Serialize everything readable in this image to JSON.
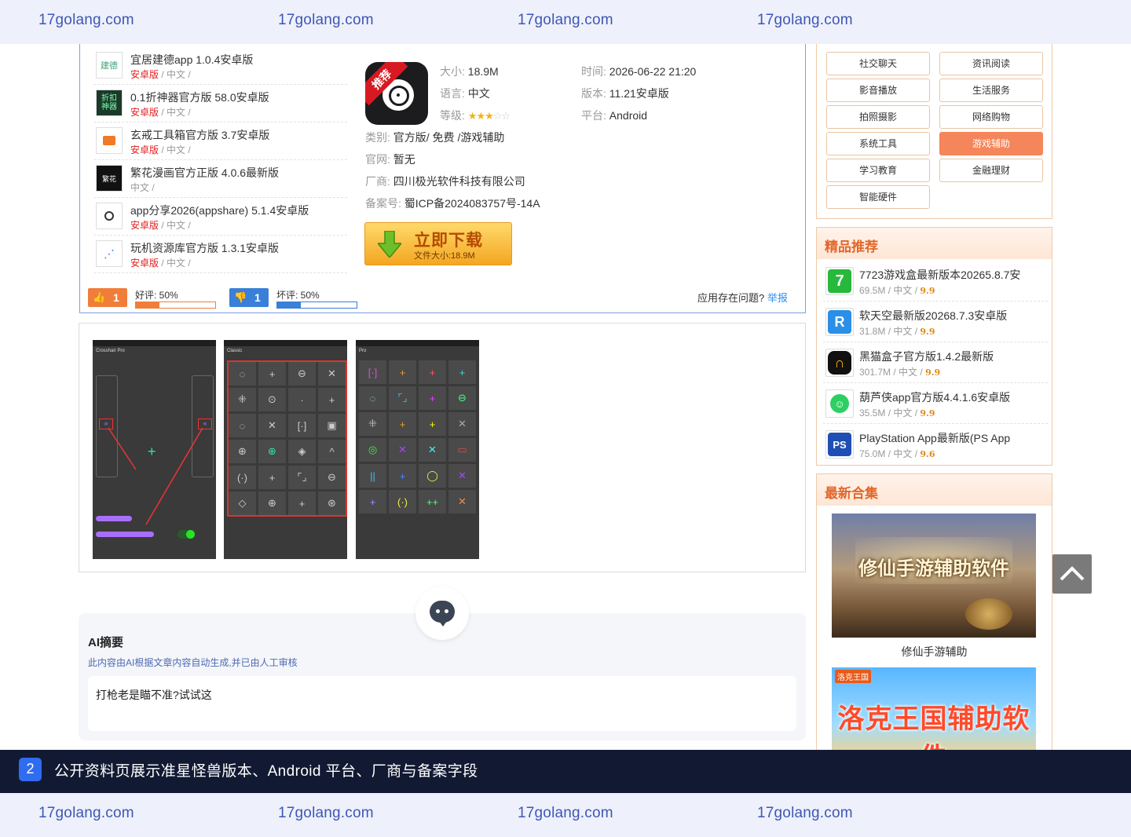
{
  "watermark": "17golang.com",
  "related_apps": [
    {
      "title": "宜居建德app 1.0.4安卓版",
      "platform": "安卓版",
      "lang": "中文",
      "icon": "yijujiande-app-icon"
    },
    {
      "title": "0.1折神器官方版 58.0安卓版",
      "platform": "安卓版",
      "lang": "中文",
      "icon": "discount-app-icon"
    },
    {
      "title": "玄戒工具箱官方版 3.7安卓版",
      "platform": "安卓版",
      "lang": "中文",
      "icon": "toolbox-app-icon"
    },
    {
      "title": "繁花漫画官方正版 4.0.6最新版",
      "platform": "",
      "lang": "中文",
      "icon": "fanhua-comic-app-icon"
    },
    {
      "title": "app分享2026(appshare) 5.1.4安卓版",
      "platform": "安卓版",
      "lang": "中文",
      "icon": "appshare-app-icon"
    },
    {
      "title": "玩机资源库官方版 1.3.1安卓版",
      "platform": "安卓版",
      "lang": "中文",
      "icon": "resource-app-icon"
    }
  ],
  "app": {
    "badge": "推荐",
    "size_label": "大小:",
    "size": "18.9M",
    "lang_label": "语言:",
    "lang": "中文",
    "rating_label": "等级:",
    "stars": 3,
    "stars_total": 5,
    "time_label": "时间:",
    "time": "2026-06-22 21:20",
    "version_label": "版本:",
    "version": "11.21安卓版",
    "platform_label": "平台:",
    "platform": "Android",
    "category_label": "类别:",
    "category": "官方版/ 免费 /游戏辅助",
    "site_label": "官网:",
    "site": "暂无",
    "vendor_label": "厂商:",
    "vendor": "四川极光软件科技有限公司",
    "icp_label": "备案号:",
    "icp": "蜀ICP备2024083757号-14A",
    "download_label": "立即下载",
    "download_size": "文件大小:18.9M"
  },
  "votes": {
    "up_count": "1",
    "up_label": "好评: 50%",
    "up_pct": 0.3,
    "down_count": "1",
    "down_label": "坏评: 50%",
    "down_pct": 0.3,
    "problem_text": "应用存在问题?",
    "report_link": "举报"
  },
  "screenshots": [
    {
      "title": "Crosshair Pro"
    },
    {
      "title": "Classic"
    },
    {
      "title": "Pro"
    }
  ],
  "ai_summary": {
    "title": "AI摘要",
    "note": "此内容由AI根据文章内容自动生成,并已由人工审核",
    "text": "打枪老是瞄不准?试试这"
  },
  "categories": [
    {
      "label": "社交聊天",
      "active": false
    },
    {
      "label": "资讯阅读",
      "active": false
    },
    {
      "label": "影音播放",
      "active": false
    },
    {
      "label": "生活服务",
      "active": false
    },
    {
      "label": "拍照摄影",
      "active": false
    },
    {
      "label": "网络购物",
      "active": false
    },
    {
      "label": "系统工具",
      "active": false
    },
    {
      "label": "游戏辅助",
      "active": true
    },
    {
      "label": "学习教育",
      "active": false
    },
    {
      "label": "金融理财",
      "active": false
    },
    {
      "label": "智能硬件",
      "active": false
    }
  ],
  "recommend": {
    "title": "精品推荐",
    "items": [
      {
        "title": "7723游戏盒最新版本20265.8.7安",
        "size": "69.5M",
        "lang": "中文",
        "score": "9.9",
        "icon": "7723-app-icon"
      },
      {
        "title": "软天空最新版20268.7.3安卓版",
        "size": "31.8M",
        "lang": "中文",
        "score": "9.9",
        "icon": "ruantiankong-app-icon"
      },
      {
        "title": "黑猫盒子官方版1.4.2最新版",
        "size": "301.7M",
        "lang": "中文",
        "score": "9.9",
        "icon": "black-cat-app-icon"
      },
      {
        "title": "葫芦侠app官方版4.4.1.6安卓版",
        "size": "35.5M",
        "lang": "中文",
        "score": "9.9",
        "icon": "huluxia-app-icon"
      },
      {
        "title": "PlayStation App最新版(PS App",
        "size": "75.0M",
        "lang": "中文",
        "score": "9.6",
        "icon": "playstation-app-icon"
      }
    ]
  },
  "collections": {
    "title": "最新合集",
    "items": [
      {
        "banner": "修仙手游辅助软件",
        "caption": "修仙手游辅助"
      },
      {
        "banner": "洛克王国辅助软件",
        "tag": "洛克王国"
      }
    ]
  },
  "caption_bar": {
    "index": "2",
    "text": "公开资料页展示准星怪兽版本、Android 平台、厂商与备案字段"
  },
  "colors": {
    "accent_orange": "#f5855a",
    "link_blue": "#2f8ef0",
    "border_blue": "#7f9ee0",
    "platform_red": "#e02020"
  }
}
